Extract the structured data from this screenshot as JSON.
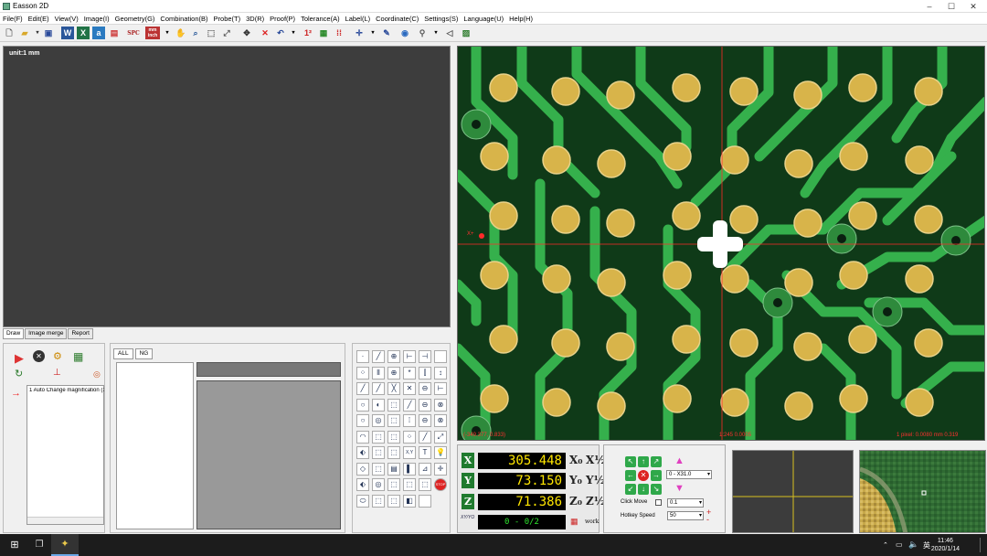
{
  "window": {
    "title": "Easson 2D",
    "min": "–",
    "max": "☐",
    "close": "✕"
  },
  "menu": [
    "File(F)",
    "Edit(E)",
    "View(V)",
    "Image(I)",
    "Geometry(G)",
    "Combination(B)",
    "Probe(T)",
    "3D(R)",
    "Proof(P)",
    "Tolerance(A)",
    "Label(L)",
    "Coordinate(C)",
    "Settings(S)",
    "Language(U)",
    "Help(H)"
  ],
  "toolbar": {
    "spc": "SPC",
    "mm": "mm",
    "inch": "inch"
  },
  "draw": {
    "unit_label": "unit:1 mm"
  },
  "left_tabs": [
    "Draw",
    "Image merge",
    "Report"
  ],
  "cmd": {
    "item": "1 Auto Change magnification (1"
  },
  "results": {
    "tabs": [
      "ALL",
      "NG"
    ]
  },
  "camera": {
    "xlabel": "X+",
    "coords_left": "(-349.377, 0.833)",
    "coords_mid": "1:245 0.0005",
    "coords_right": "1 pixel: 0.0080 mm 0.319"
  },
  "coords": {
    "x_label": "X",
    "x_value": "305.448",
    "y_label": "Y",
    "y_value": "73.150",
    "z_label": "Z",
    "z_value": "71.386",
    "x0": "X₀",
    "x_half": "X½",
    "y0": "Y₀",
    "y_half": "Y½",
    "z0": "Z₀",
    "z_half": "Z½",
    "xy_btn": "XY/YO",
    "counter": "0 - 0/2",
    "work": "work"
  },
  "move": {
    "mag_select": "0 - X31.0",
    "click_move": "Click Move",
    "step": "0.1",
    "hotkey_speed": "Hotkey Speed",
    "speed": "50",
    "plus": "+",
    "minus": "-"
  },
  "taskbar": {
    "tray_lang": "英",
    "time": "11:46",
    "date": "2020/1/14"
  },
  "colors": {
    "pcb": "#0f3a18",
    "trace": "#35b04c",
    "pad": "#d8b44a",
    "cross": "#ff2a2a"
  }
}
